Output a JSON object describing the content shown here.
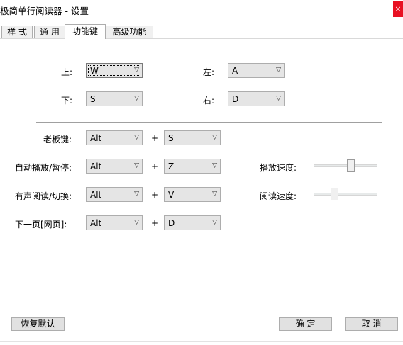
{
  "window": {
    "title": "极简单行阅读器 - 设置",
    "close_label": "×"
  },
  "tabs": [
    {
      "label": "样 式"
    },
    {
      "label": "通 用"
    },
    {
      "label": "功能键"
    },
    {
      "label": "高级功能"
    }
  ],
  "direction_keys": {
    "up": {
      "label": "上:",
      "value": "W"
    },
    "down": {
      "label": "下:",
      "value": "S"
    },
    "left": {
      "label": "左:",
      "value": "A"
    },
    "right": {
      "label": "右:",
      "value": "D"
    }
  },
  "plus_sign": "+",
  "hotkeys": {
    "boss_key": {
      "label": "老板键:",
      "modifier": "Alt",
      "key": "S"
    },
    "auto_play": {
      "label": "自动播放/暂停:",
      "modifier": "Alt",
      "key": "Z"
    },
    "voice_read": {
      "label": "有声阅读/切换:",
      "modifier": "Alt",
      "key": "V"
    },
    "next_page": {
      "label": "下一页[网页]:",
      "modifier": "Alt",
      "key": "D"
    }
  },
  "speeds": {
    "play_speed": {
      "label": "播放速度:",
      "level": 0.6
    },
    "read_speed": {
      "label": "阅读速度:",
      "level": 0.3
    }
  },
  "buttons": {
    "restore_default": "恢复默认",
    "ok": "确 定",
    "cancel": "取 消"
  },
  "icons": {
    "dropdown": "chevron-down-icon",
    "close": "close-icon"
  }
}
